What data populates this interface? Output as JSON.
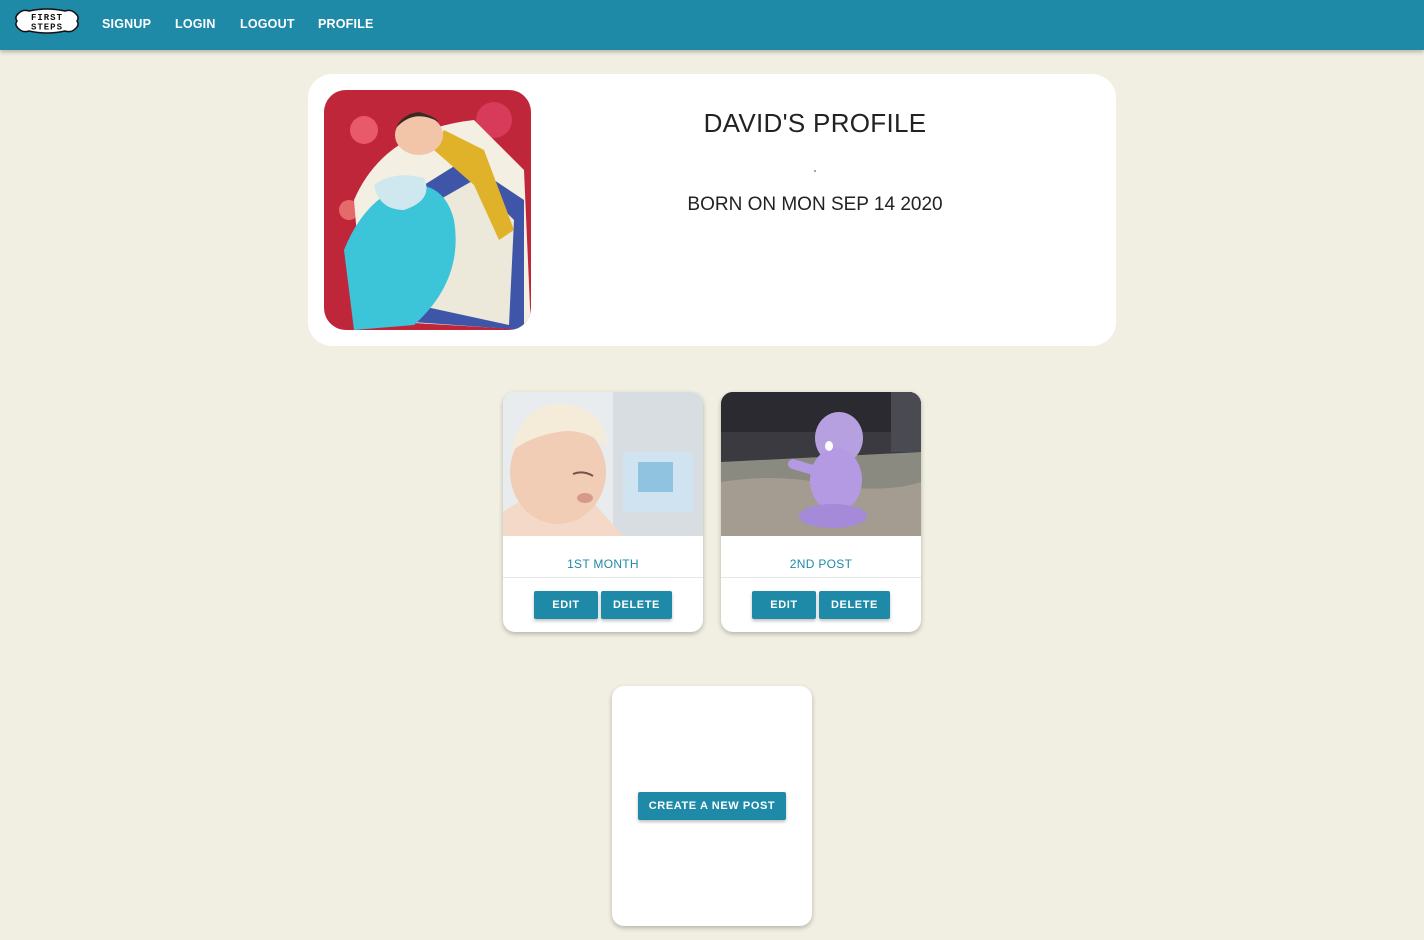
{
  "navbar": {
    "logo_text_top": "FIRST",
    "logo_text_bottom": "STEPS",
    "links": [
      "SIGNUP",
      "LOGIN",
      "LOGOUT",
      "PROFILE"
    ]
  },
  "profile": {
    "title": "DAVID'S PROFILE",
    "born": "BORN ON MON SEP 14 2020"
  },
  "posts": [
    {
      "title": "1ST MONTH",
      "edit_label": "EDIT",
      "delete_label": "DELETE"
    },
    {
      "title": "2ND POST",
      "edit_label": "EDIT",
      "delete_label": "DELETE"
    }
  ],
  "create_post": {
    "label": "CREATE A NEW POST"
  },
  "colors": {
    "accent": "#1f8aa8",
    "background": "#f1efe1"
  }
}
